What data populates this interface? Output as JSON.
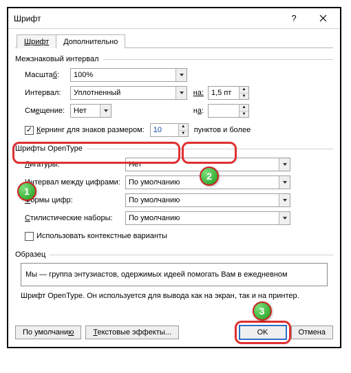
{
  "title": "Шрифт",
  "tabs": {
    "font": "Шрифт",
    "advanced": "Дополнительно"
  },
  "group1": "Межзнаковый интервал",
  "scale": {
    "label": "Масштаб:",
    "value": "100%"
  },
  "spacing": {
    "label": "Интервал:",
    "value": "Уплотненный",
    "by_label": "на:",
    "by_value": "1,5 пт"
  },
  "position": {
    "label": "Смещение:",
    "value": "Нет",
    "by_label": "на:",
    "by_value": ""
  },
  "kerning": {
    "label": "Кернинг для знаков размером:",
    "value": "10",
    "suffix": "пунктов и более"
  },
  "group2": "Шрифты OpenType",
  "ligatures": {
    "label": "Лигатуры:",
    "value": "Нет"
  },
  "numspacing": {
    "label": "Интервал между цифрами:",
    "value": "По умолчанию"
  },
  "numforms": {
    "label": "Формы цифр:",
    "value": "По умолчанию"
  },
  "stylistic": {
    "label": "Стилистические наборы:",
    "value": "По умолчанию"
  },
  "contextual": {
    "label": "Использовать контекстные варианты"
  },
  "sample_label": "Образец",
  "sample_text": "Мы — группа энтузиастов, одержимых идеей помогать Вам в ежедневном",
  "note": "Шрифт OpenType. Он используется для вывода как на экран, так и на принтер.",
  "buttons": {
    "default": "По умолчанию",
    "effects": "Текстовые эффекты...",
    "ok": "OK",
    "cancel": "Отмена"
  },
  "markers": {
    "m1": "1",
    "m2": "2",
    "m3": "3"
  }
}
